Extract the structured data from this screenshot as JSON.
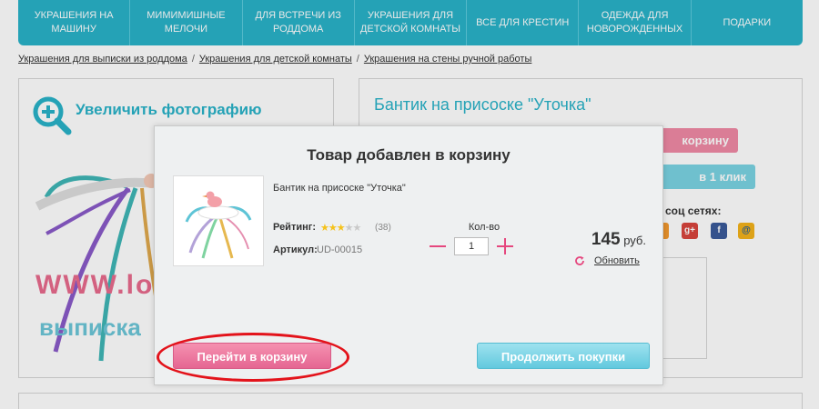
{
  "nav": {
    "items": [
      {
        "label": "Украшения на машину"
      },
      {
        "label": "Мимимишные мелочи"
      },
      {
        "label": "Для встречи из роддома"
      },
      {
        "label": "Украшения для детской комнаты"
      },
      {
        "label": "Все для крестин"
      },
      {
        "label": "Одежда для новорожденных"
      },
      {
        "label": "Подарки"
      }
    ]
  },
  "breadcrumb": {
    "items": [
      "Украшения для выписки из роддома",
      "Украшения для детской комнаты",
      "Украшения на стены ручной работы"
    ],
    "separator": "/"
  },
  "photo": {
    "zoom_label": "Увеличить фотографию",
    "watermark_line1": "WWW.lov",
    "watermark_line2": "выписка"
  },
  "product": {
    "title": "Бантик на присоске \"Уточка\"",
    "cart_button_partial": "корзину",
    "one_click_partial": "в 1 клик",
    "social_label_partial": "соц сетях:"
  },
  "modal": {
    "title": "Товар добавлен в корзину",
    "product_name": "Бантик на присоске \"Уточка\"",
    "rating_label": "Рейтинг:",
    "rating_value": 3,
    "rating_max": 5,
    "reviews_count": "(38)",
    "sku_label": "Артикул:",
    "sku_value": "UD-00015",
    "qty_label": "Кол-во",
    "qty_value": "1",
    "price_amount": "145",
    "price_currency": "руб.",
    "refresh_label": "Обновить",
    "go_to_cart": "Перейти в корзину",
    "continue_shopping": "Продолжить покупки"
  },
  "colors": {
    "brand_teal": "#29b3c9",
    "cart_pink": "#e56692",
    "continue_blue": "#62c9de",
    "highlight_red": "#e3131b"
  }
}
